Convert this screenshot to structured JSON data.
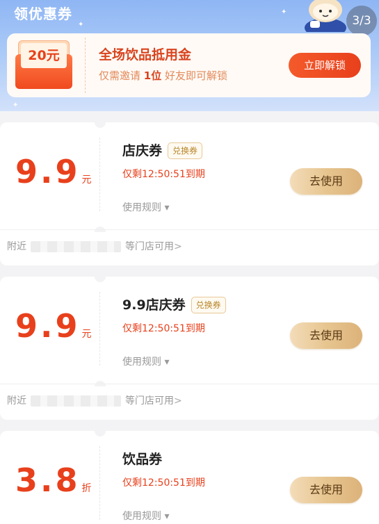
{
  "header": {
    "title": "领优惠券",
    "page_counter": "3/3"
  },
  "promo": {
    "ticket_value": "20元",
    "title": "全场饮品抵用金",
    "subtitle_pre": "仅需邀请",
    "subtitle_num": "1位",
    "subtitle_post": "好友即可解锁",
    "button_label": "立即解锁"
  },
  "coupons": [
    {
      "amount": "9.9",
      "unit": "元",
      "name": "店庆券",
      "badge": "兑换券",
      "expiry": "仅剩12:50:51到期",
      "rules_label": "使用规则",
      "rules_arrow": "▾",
      "button_label": "去使用",
      "store_prefix": "附近",
      "store_suffix": "等门店可用",
      "store_arrow": ">"
    },
    {
      "amount": "9.9",
      "unit": "元",
      "name": "9.9店庆券",
      "badge": "兑换券",
      "expiry": "仅剩12:50:51到期",
      "rules_label": "使用规则",
      "rules_arrow": "▾",
      "button_label": "去使用",
      "store_prefix": "附近",
      "store_suffix": "等门店可用",
      "store_arrow": ">"
    },
    {
      "amount": "3.8",
      "unit": "折",
      "name": "饮品券",
      "expiry": "仅剩12:50:51到期",
      "rules_label": "使用规则",
      "rules_arrow": "▾",
      "button_label": "去使用"
    }
  ],
  "colors": {
    "accent_red": "#e8401c",
    "header_blue": "#8fb6f4",
    "gold_button": "#e7c58f"
  },
  "icons": {
    "mascot": "astronaut-mascot-icon",
    "rules_arrow": "caret-down-icon",
    "store_arrow": "chevron-right-icon"
  }
}
